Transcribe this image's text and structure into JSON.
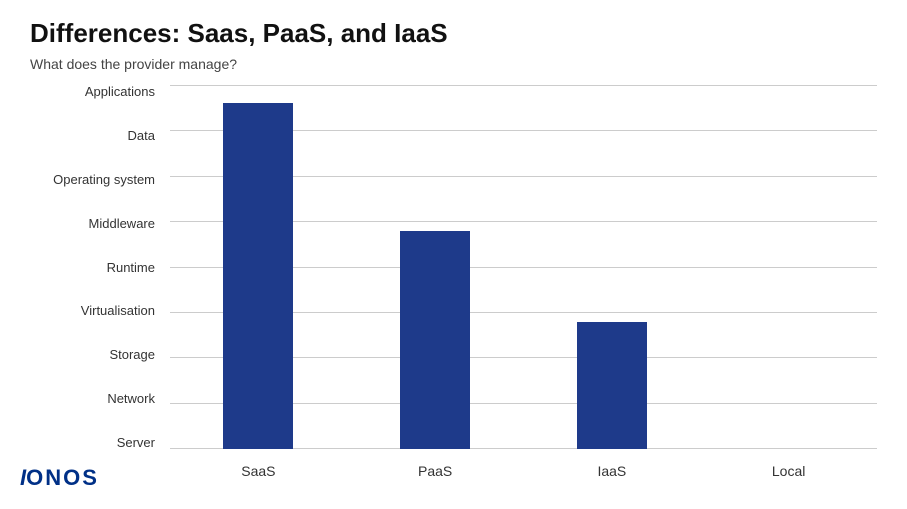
{
  "title": "Differences: Saas, PaaS, and IaaS",
  "subtitle": "What does the provider manage?",
  "y_labels": [
    "Applications",
    "Data",
    "Operating system",
    "Middleware",
    "Runtime",
    "Virtualisation",
    "Storage",
    "Network",
    "Server"
  ],
  "bars": [
    {
      "label": "SaaS",
      "height_pct": 95
    },
    {
      "label": "PaaS",
      "height_pct": 60
    },
    {
      "label": "IaaS",
      "height_pct": 35
    },
    {
      "label": "Local",
      "height_pct": 0
    }
  ],
  "bar_color": "#1e3a8a",
  "logo": "IONOS"
}
